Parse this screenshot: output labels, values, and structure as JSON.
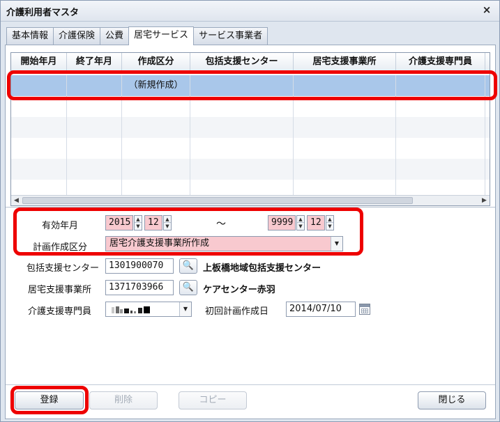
{
  "window": {
    "title": "介護利用者マスタ",
    "close_glyph": "×"
  },
  "tabs": [
    {
      "label": "基本情報"
    },
    {
      "label": "介護保険"
    },
    {
      "label": "公費"
    },
    {
      "label": "居宅サービス"
    },
    {
      "label": "サービス事業者"
    }
  ],
  "active_tab_index": 3,
  "grid": {
    "columns": [
      "開始年月",
      "終了年月",
      "作成区分",
      "包括支援センター",
      "居宅支援事業所",
      "介護支援専門員"
    ],
    "rows": [
      [
        "",
        "",
        "（新規作成）",
        "",
        "",
        ""
      ]
    ]
  },
  "form": {
    "valid_label": "有効年月",
    "start_year": "2015",
    "start_month": "12",
    "tilde": "～",
    "end_year": "9999",
    "end_month": "12",
    "plan_type_label": "計画作成区分",
    "plan_type_value": "居宅介護支援事業所作成",
    "center_label": "包括支援センター",
    "center_code": "1301900070",
    "center_name": "上板橋地域包括支援センター",
    "office_label": "居宅支援事業所",
    "office_code": "1371703966",
    "office_name": "ケアセンター赤羽",
    "manager_label": "介護支援専門員",
    "first_plan_label": "初回計画作成日",
    "first_plan_date": "2014/07/10"
  },
  "buttons": {
    "register": "登録",
    "delete": "削除",
    "copy": "コピー",
    "close": "閉じる"
  },
  "colors": {
    "highlight": "#ee0000",
    "selected_row": "#a9c7ea",
    "required_field": "#f8c9cf"
  }
}
